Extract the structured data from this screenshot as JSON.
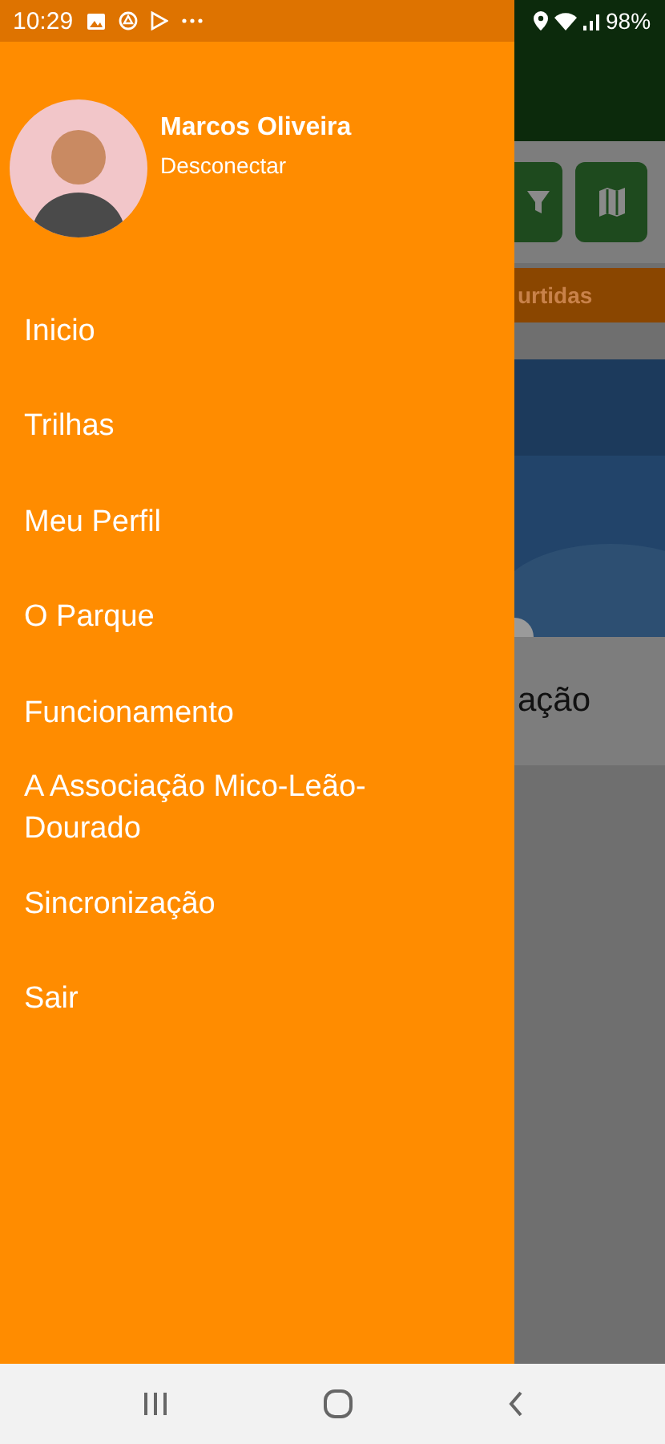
{
  "status_bar": {
    "time": "10:29",
    "battery": "98%"
  },
  "drawer": {
    "user_name": "Marcos Oliveira",
    "sign_out_link": "Desconectar",
    "items": [
      {
        "label": "Inicio"
      },
      {
        "label": "Trilhas"
      },
      {
        "label": "Meu Perfil"
      },
      {
        "label": "O Parque"
      },
      {
        "label": "Funcionamento"
      },
      {
        "label": "A Associação Mico-Leão-Dourado"
      },
      {
        "label": "Sincronização"
      },
      {
        "label": "Sair"
      }
    ]
  },
  "background": {
    "tab_label": "urtidas",
    "card_title": "ação"
  }
}
